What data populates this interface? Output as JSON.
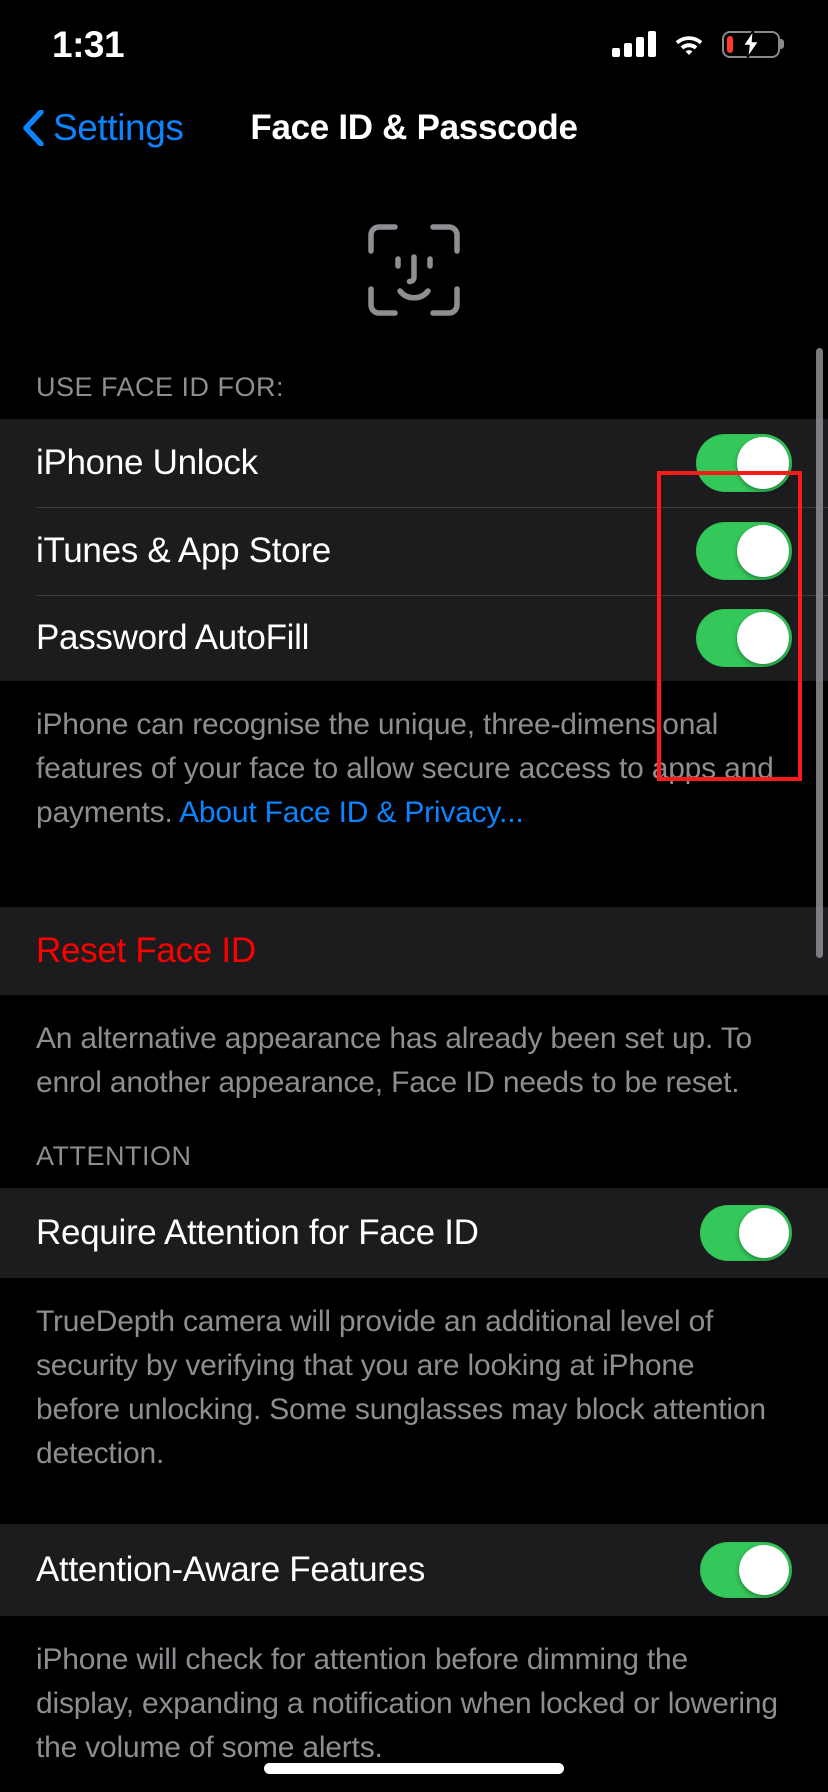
{
  "status_bar": {
    "time": "1:31",
    "signal_icon": "cellular-signal-icon",
    "signal_bars": 4,
    "wifi_icon": "wifi-icon",
    "battery_icon": "battery-charging-icon",
    "battery_low_color": "#ff3b30"
  },
  "nav": {
    "back_icon": "chevron-left-icon",
    "back_label": "Settings",
    "title": "Face ID & Passcode"
  },
  "hero": {
    "icon": "face-id-icon"
  },
  "sections": {
    "use_face_id": {
      "header": "USE FACE ID FOR:",
      "rows": [
        {
          "label": "iPhone Unlock",
          "toggle": "on"
        },
        {
          "label": "iTunes & App Store",
          "toggle": "on"
        },
        {
          "label": "Password AutoFill",
          "toggle": "on"
        }
      ],
      "footnote_text": "iPhone can recognise the unique, three-dimensional features of your face to allow secure access to apps and payments. ",
      "footnote_link": "About Face ID & Privacy..."
    },
    "reset": {
      "row_label": "Reset Face ID",
      "footnote": "An alternative appearance has already been set up. To enrol another appearance, Face ID needs to be reset."
    },
    "attention": {
      "header": "ATTENTION",
      "rows": [
        {
          "label": "Require Attention for Face ID",
          "toggle": "on"
        }
      ],
      "footnote": "TrueDepth camera will provide an additional level of security by verifying that you are looking at iPhone before unlocking. Some sunglasses may block attention detection."
    },
    "attention_aware": {
      "rows": [
        {
          "label": "Attention-Aware Features",
          "toggle": "on"
        }
      ],
      "footnote": "iPhone will check for attention before dimming the display, expanding a notification when locked or lowering the volume of some alerts."
    }
  },
  "annotation": {
    "name": "highlight-box-face-id-toggles",
    "color": "#ff1a1a"
  },
  "colors": {
    "accent_blue": "#0a84ff",
    "toggle_green": "#34c759",
    "destructive_red": "#ff0000",
    "cell_bg": "#1c1c1e",
    "page_bg": "#000000",
    "secondary_text": "#8d8d92"
  }
}
